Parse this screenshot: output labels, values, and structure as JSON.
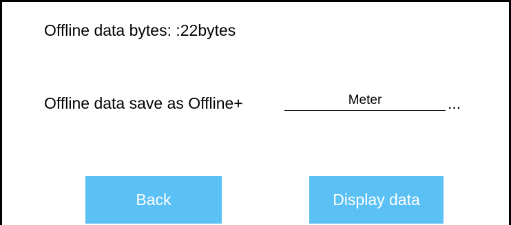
{
  "offline": {
    "bytes_text": "Offline data bytes: :22bytes",
    "save_label": "Offline data save as Offline+",
    "filename_value": "Meter",
    "ellipsis": "..."
  },
  "buttons": {
    "back_label": "Back",
    "display_label": "Display data"
  },
  "colors": {
    "button_background": "#5bc0f4",
    "button_text": "#ffffff",
    "border": "#000000",
    "background": "#ffffff"
  }
}
